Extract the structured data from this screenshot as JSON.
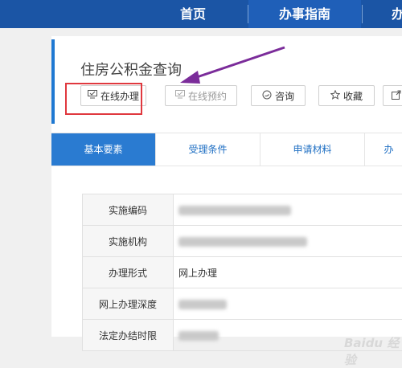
{
  "nav": {
    "items": [
      {
        "label": "首页"
      },
      {
        "label": "办事指南"
      },
      {
        "label": "办"
      }
    ]
  },
  "page": {
    "title": "住房公积金查询"
  },
  "actions": {
    "online": {
      "label": "在线办理",
      "icon": "monitor-icon"
    },
    "appoint": {
      "label": "在线预约",
      "icon": "monitor-icon"
    },
    "consult": {
      "label": "咨询",
      "icon": "chat-icon"
    },
    "favorite": {
      "label": "收藏",
      "icon": "star-icon"
    },
    "share": {
      "icon": "share-icon"
    }
  },
  "tabs": [
    {
      "label": "基本要素"
    },
    {
      "label": "受理条件"
    },
    {
      "label": "申请材料"
    },
    {
      "label": "办"
    }
  ],
  "table": {
    "rows": [
      {
        "label": "实施编码",
        "value": ""
      },
      {
        "label": "实施机构",
        "value": ""
      },
      {
        "label": "办理形式",
        "value": "网上办理"
      },
      {
        "label": "网上办理深度",
        "value": ""
      },
      {
        "label": "法定办结时限",
        "value": ""
      }
    ]
  },
  "watermark": {
    "text": "Baidu 经验"
  },
  "colors": {
    "nav_bg": "#1b55a5",
    "accent": "#2a7bd1",
    "highlight": "#e0383e",
    "arrow": "#7b2c9a"
  }
}
